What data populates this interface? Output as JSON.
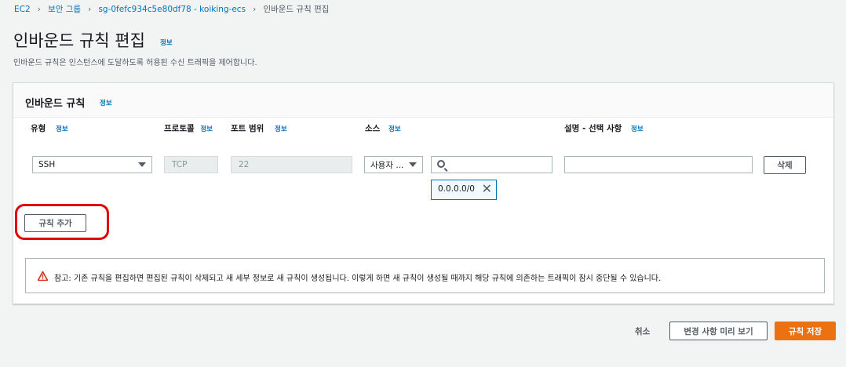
{
  "breadcrumb": {
    "items": [
      "EC2",
      "보안 그룹",
      "sg-0fefc934c5e80df78 - koiking-ecs"
    ],
    "current": "인바운드 규칙 편집"
  },
  "header": {
    "title": "인바운드 규칙 편집",
    "info": "정보",
    "description": "인바운드 규칙은 인스턴스에 도달하도록 허용된 수신 트래픽을 제어합니다."
  },
  "section": {
    "title": "인바운드 규칙",
    "info": "정보"
  },
  "columns": [
    {
      "label": "유형",
      "info": "정보"
    },
    {
      "label": "프로토콜",
      "info": "정보"
    },
    {
      "label": "포트 범위",
      "info": "정보"
    },
    {
      "label": "소스",
      "info": "정보"
    },
    {
      "label": "설명 - 선택 사항",
      "info": "정보"
    }
  ],
  "rule": {
    "type": "SSH",
    "protocol": "TCP",
    "port_range": "22",
    "source_type": "사용자 ...",
    "source_search_value": "",
    "source_token": "0.0.0.0/0",
    "description_value": "",
    "delete_label": "삭제"
  },
  "add_rule_label": "규칙 추가",
  "alert": {
    "text": "참고: 기존 규칙을 편집하면 편집된 규칙이 삭제되고 새 세부 정보로 새 규칙이 생성됩니다. 이렇게 하면 새 규칙이 생성될 때까지 해당 규칙에 의존하는 트래픽이 잠시 중단될 수 있습니다."
  },
  "footer": {
    "cancel_label": "취소",
    "preview_label": "변경 사항 미리 보기",
    "save_label": "규칙 저장"
  },
  "colors": {
    "link": "#0073bb",
    "primary": "#ec7211",
    "warning": "#d13212",
    "highlight": "#e00000"
  }
}
